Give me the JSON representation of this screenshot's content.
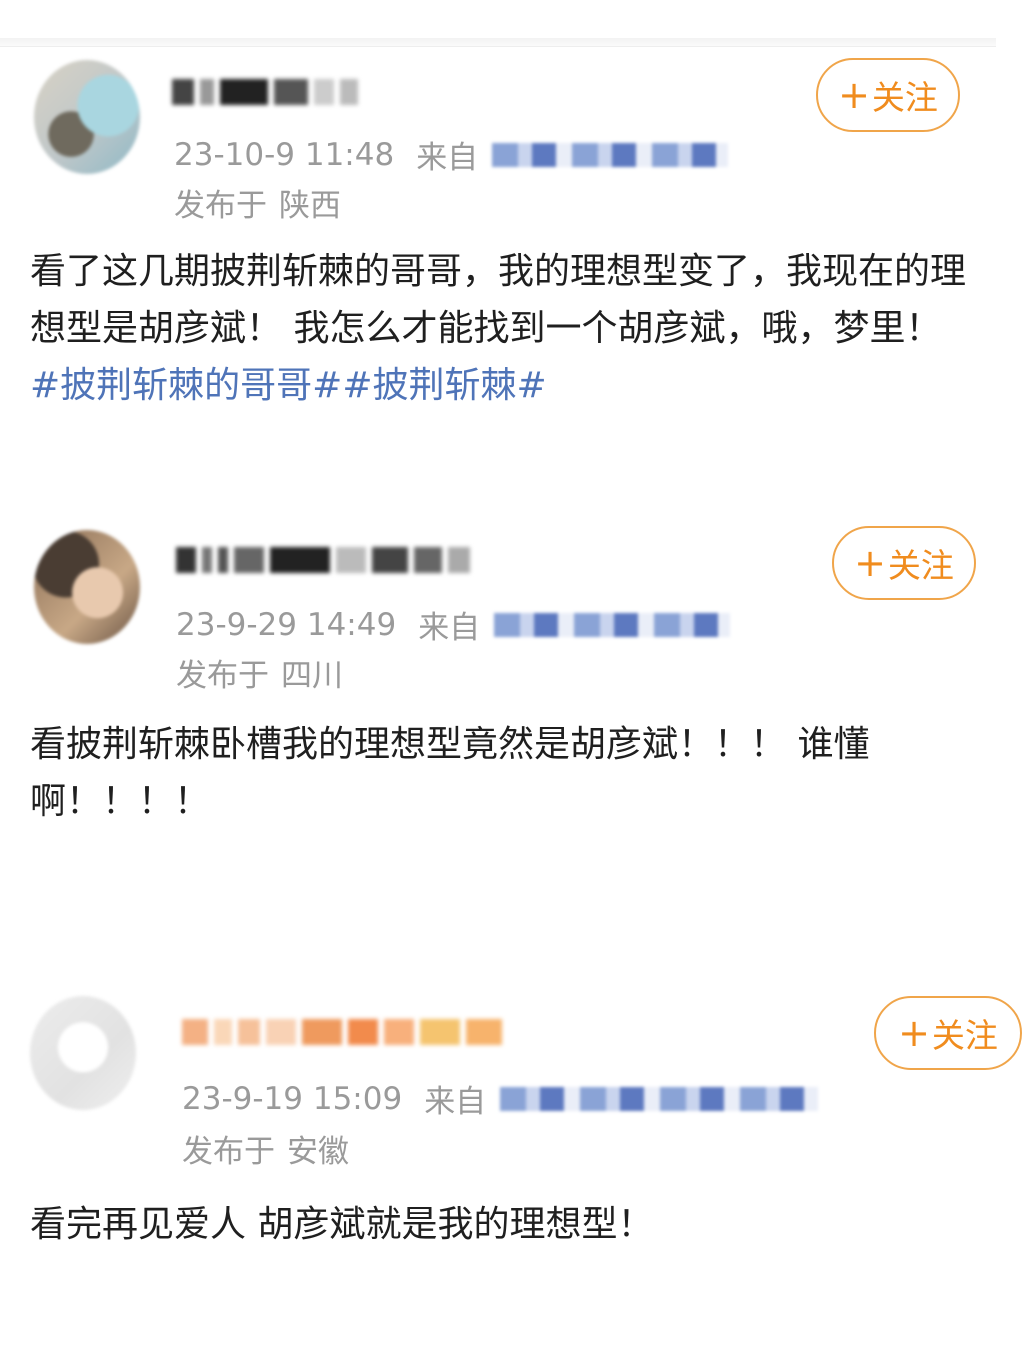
{
  "posts": [
    {
      "time": "23-10-9 11:48",
      "from_label": "来自",
      "region_label": "发布于",
      "region": "陕西",
      "follow_label": "关注",
      "text": "看了这几期披荆斩棘的哥哥，我的理想型变了，我现在的理想型是胡彦斌！ 我怎么才能找到一个胡彦斌，哦，梦里！ ",
      "tags": [
        "#披荆斩棘的哥哥#",
        "#披荆斩棘#"
      ]
    },
    {
      "time": "23-9-29 14:49",
      "from_label": "来自",
      "region_label": "发布于",
      "region": "四川",
      "follow_label": "关注",
      "text": "看披荆斩棘卧槽我的理想型竟然是胡彦斌！！！ 谁懂啊！！！！"
    },
    {
      "time": "23-9-19 15:09",
      "from_label": "来自",
      "region_label": "发布于",
      "region": "安徽",
      "follow_label": "关注",
      "text": "看完再见爱人 胡彦斌就是我的理想型！"
    }
  ],
  "colors": {
    "accent": "#f08c1e",
    "tag": "#4f74b8",
    "meta": "#9a9a9a"
  },
  "icons": {
    "follow": "plus-icon"
  }
}
